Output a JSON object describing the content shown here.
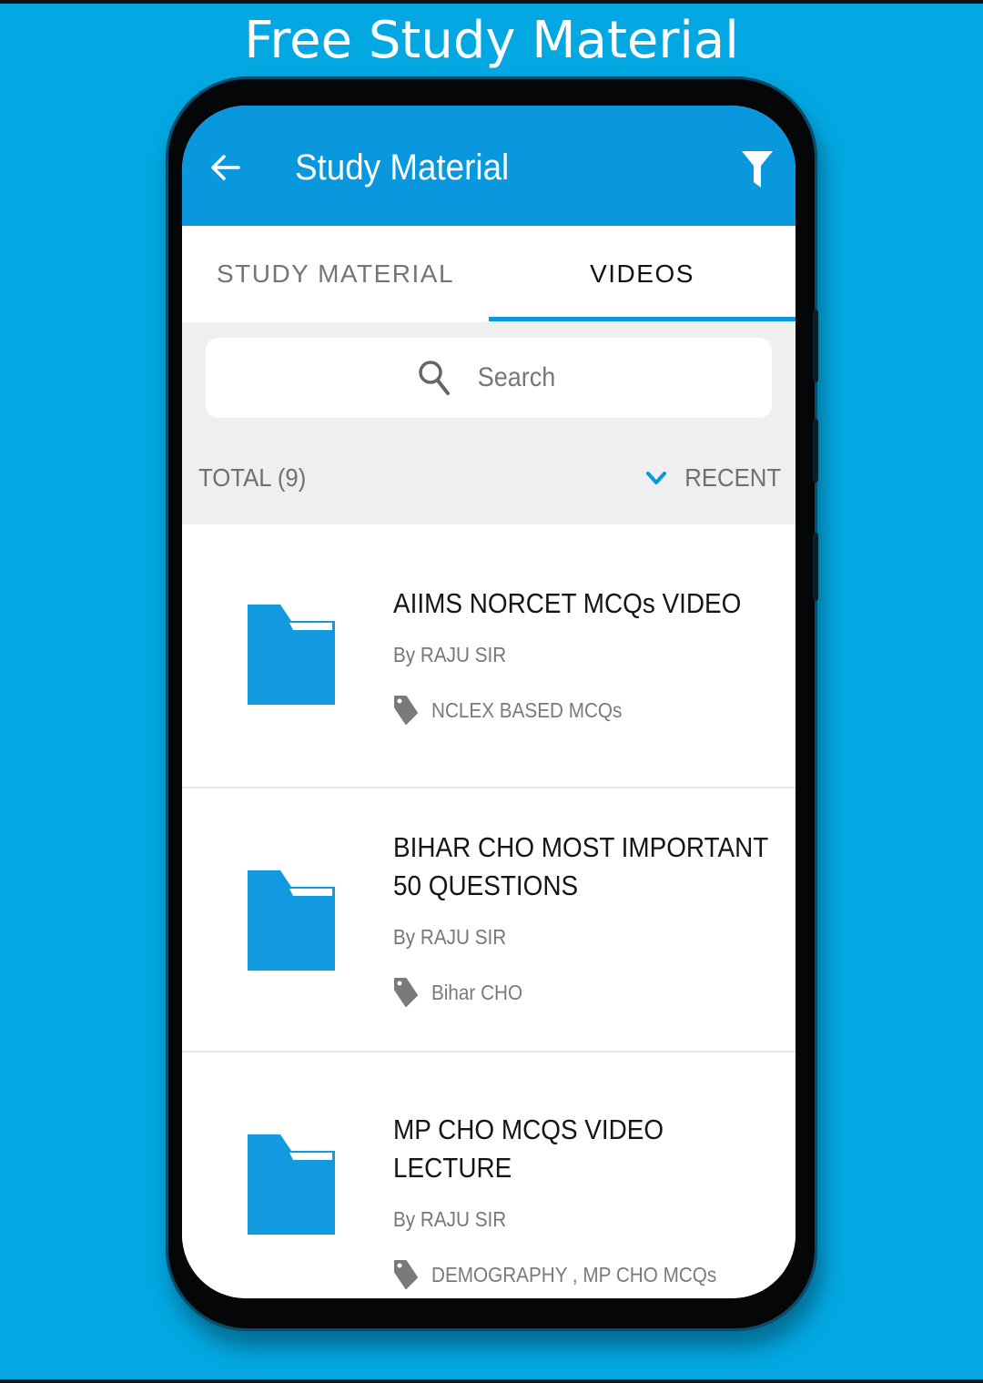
{
  "promo": {
    "title": "Free Study Material"
  },
  "appbar": {
    "title": "Study Material",
    "back_icon": "arrow-left-icon",
    "filter_icon": "filter-funnel-icon",
    "color": "#0998dd"
  },
  "tabs": [
    {
      "label": "STUDY MATERIAL",
      "active": false
    },
    {
      "label": "VIDEOS",
      "active": true
    }
  ],
  "search": {
    "placeholder": "Search",
    "value": ""
  },
  "summary": {
    "total_label": "TOTAL (9)",
    "sort_label": "RECENT",
    "sort_icon": "chevron-down-icon"
  },
  "items": [
    {
      "title": "AIIMS NORCET MCQs VIDEO",
      "author": "By RAJU SIR",
      "tags": "NCLEX BASED MCQs"
    },
    {
      "title": "BIHAR CHO MOST IMPORTANT 50 QUESTIONS",
      "author": "By RAJU SIR",
      "tags": "Bihar CHO"
    },
    {
      "title": "MP CHO MCQS VIDEO LECTURE",
      "author": "By RAJU SIR",
      "tags": "DEMOGRAPHY , MP CHO MCQs"
    }
  ],
  "colors": {
    "background": "#03a8e2",
    "accent": "#0998dd",
    "folder": "#129ae0",
    "tag_icon": "#7a7a7a"
  }
}
